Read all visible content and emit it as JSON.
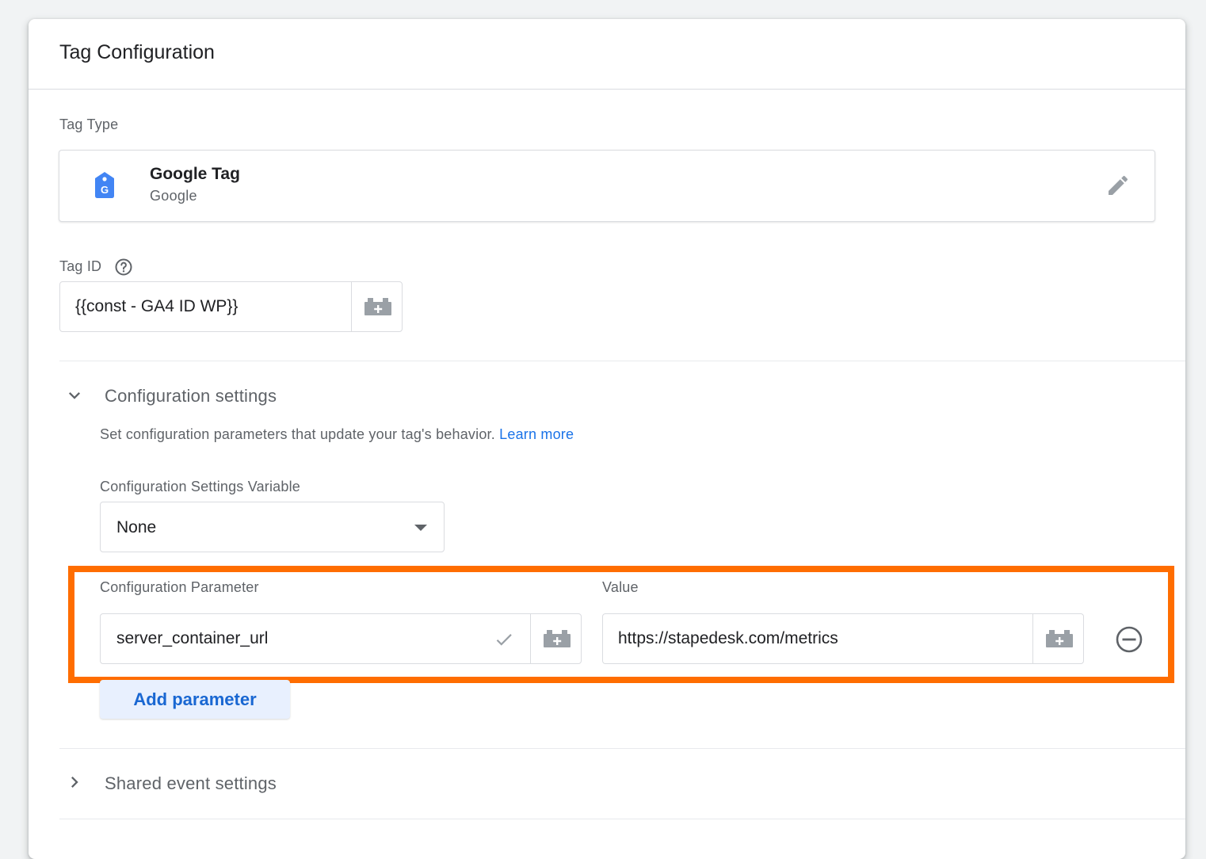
{
  "card": {
    "title": "Tag Configuration"
  },
  "tag_type": {
    "label": "Tag Type",
    "name": "Google Tag",
    "vendor": "Google",
    "icon": "google-tag-icon",
    "edit_icon": "pencil-icon",
    "icon_color": "#4285f4"
  },
  "tag_id": {
    "label": "Tag ID",
    "help_icon": "help-circle-icon",
    "value": "{{const - GA4 ID WP}}",
    "variable_icon": "variable-picker-icon"
  },
  "config_settings": {
    "title": "Configuration settings",
    "expanded": true,
    "description": "Set configuration parameters that update your tag's behavior.",
    "learn_more": "Learn more",
    "variable_label": "Configuration Settings Variable",
    "variable_value": "None",
    "param_header": "Configuration Parameter",
    "value_header": "Value",
    "rows": [
      {
        "parameter": "server_container_url",
        "value": "https://stapedesk.com/metrics"
      }
    ],
    "add_param_label": "Add parameter",
    "highlight_color": "#ff6d00"
  },
  "shared_event": {
    "title": "Shared event settings",
    "expanded": false
  },
  "colors": {
    "link": "#1a73e8",
    "button_text": "#1967d2",
    "button_bg": "#e8f0fe"
  }
}
